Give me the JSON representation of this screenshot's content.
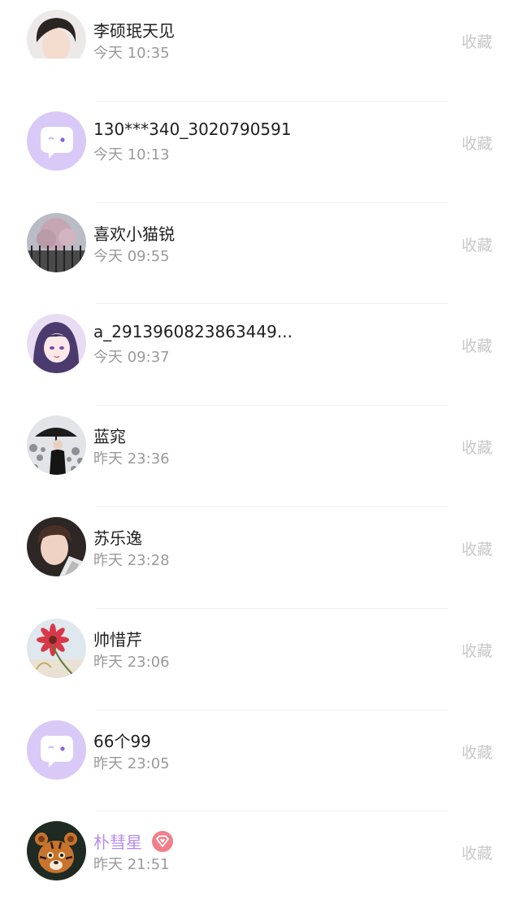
{
  "colors": {
    "name": "#1f1f1f",
    "time": "#9a9a9a",
    "collect": "#c8c8c8",
    "vip_name": "#b58cf0",
    "vip_badge": "#f07f8a",
    "default_avatar": "#d9c9f7"
  },
  "visitors": [
    {
      "name": "李硕珉天见",
      "time": "今天 10:35",
      "action": "收藏",
      "avatar": "photo-boy-bangs"
    },
    {
      "name": "130***340_3020790591",
      "time": "今天 10:13",
      "action": "收藏",
      "avatar": "default-chat-bubble"
    },
    {
      "name": "喜欢小猫锐",
      "time": "今天 09:55",
      "action": "收藏",
      "avatar": "photo-blossom-tree"
    },
    {
      "name": "a_2913960823863449...",
      "time": "今天 09:37",
      "action": "收藏",
      "avatar": "anime-girl-purple"
    },
    {
      "name": "蓝窕",
      "time": "昨天 23:36",
      "action": "收藏",
      "avatar": "photo-person-umbrella-snow"
    },
    {
      "name": "苏乐逸",
      "time": "昨天 23:28",
      "action": "收藏",
      "avatar": "photo-boy-portrait"
    },
    {
      "name": "帅惜芹",
      "time": "昨天 23:06",
      "action": "收藏",
      "avatar": "photo-red-flower"
    },
    {
      "name": "66个99",
      "time": "昨天 23:05",
      "action": "收藏",
      "avatar": "default-chat-bubble"
    },
    {
      "name": "朴彗星",
      "time": "昨天 21:51",
      "action": "收藏",
      "avatar": "tiger-cub",
      "vip": true,
      "badge_icon": "diamond-heart-icon"
    }
  ]
}
